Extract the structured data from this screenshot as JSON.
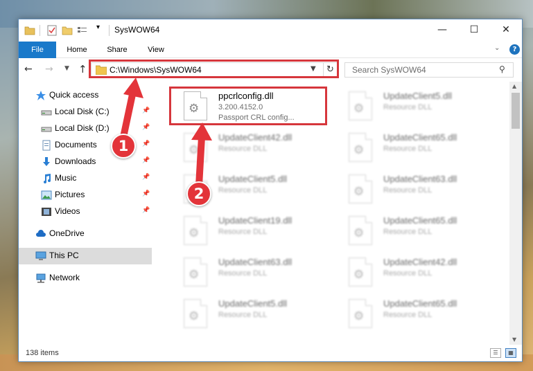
{
  "window": {
    "title": "SysWOW64",
    "minimize_glyph": "—",
    "maximize_glyph": "☐",
    "close_glyph": "✕"
  },
  "ribbon": {
    "tabs": [
      {
        "label": "File",
        "active": true
      },
      {
        "label": "Home"
      },
      {
        "label": "Share"
      },
      {
        "label": "View"
      }
    ],
    "help_glyph": "?"
  },
  "address": {
    "path": "C:\\Windows\\SysWOW64"
  },
  "search": {
    "placeholder": "Search SysWOW64"
  },
  "sidebar": {
    "items": [
      {
        "label": "Quick access",
        "icon": "star-icon",
        "pinned": false
      },
      {
        "label": "Local Disk (C:)",
        "icon": "drive-icon",
        "pinned": true
      },
      {
        "label": "Local Disk (D:)",
        "icon": "drive-icon",
        "pinned": true
      },
      {
        "label": "Documents",
        "icon": "documents-icon",
        "pinned": true
      },
      {
        "label": "Downloads",
        "icon": "download-icon",
        "pinned": true
      },
      {
        "label": "Music",
        "icon": "music-icon",
        "pinned": true
      },
      {
        "label": "Pictures",
        "icon": "pictures-icon",
        "pinned": true
      },
      {
        "label": "Videos",
        "icon": "videos-icon",
        "pinned": true
      },
      {
        "label": "OneDrive",
        "icon": "cloud-icon",
        "pinned": false
      },
      {
        "label": "This PC",
        "icon": "computer-icon",
        "selected": true
      },
      {
        "label": "Network",
        "icon": "network-icon",
        "pinned": false
      }
    ]
  },
  "files": [
    {
      "name": "ppcrlconfig.dll",
      "version": "3.200.4152.0",
      "description": "Passport CRL config...",
      "highlighted": true
    },
    {
      "name": "UpdateClient5.dll",
      "description": "Resource DLL"
    },
    {
      "name": "UpdateClient42.dll",
      "description": "Resource DLL"
    },
    {
      "name": "UpdateClient65.dll",
      "description": "Resource DLL"
    },
    {
      "name": "UpdateClient5.dll",
      "description": "Resource DLL"
    },
    {
      "name": "UpdateClient63.dll",
      "description": "Resource DLL"
    },
    {
      "name": "UpdateClient19.dll",
      "description": "Resource DLL"
    },
    {
      "name": "UpdateClient65.dll",
      "description": "Resource DLL"
    },
    {
      "name": "UpdateClient63.dll",
      "description": "Resource DLL"
    },
    {
      "name": "UpdateClient42.dll",
      "description": "Resource DLL"
    },
    {
      "name": "UpdateClient5.dll",
      "description": "Resource DLL"
    },
    {
      "name": "UpdateClient65.dll",
      "description": "Resource DLL"
    }
  ],
  "status": {
    "item_count": "138 items"
  },
  "annotations": {
    "step1": "1",
    "step2": "2",
    "color": "#e3343a"
  }
}
